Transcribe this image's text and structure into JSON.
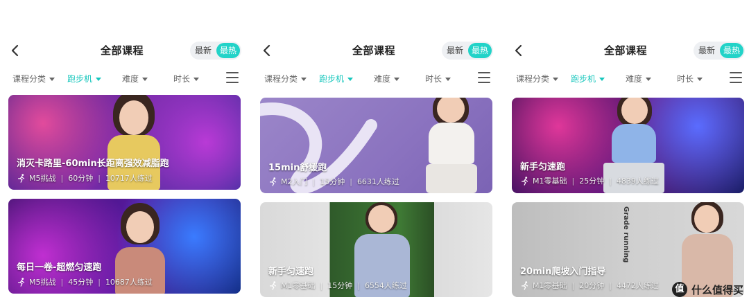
{
  "screens": [
    {
      "title": "全部课程",
      "sort": {
        "new": "最新",
        "hot": "最热"
      },
      "filters": [
        "课程分类",
        "跑步机",
        "难度",
        "时长"
      ],
      "cards": [
        {
          "title": "消灭卡路里-60min长距离强效减脂跑",
          "level": "M5挑战",
          "duration": "60分钟",
          "participants": "10717人练过"
        },
        {
          "title": "每日一卷-超燃匀速跑",
          "level": "M5挑战",
          "duration": "45分钟",
          "participants": "10687人练过"
        }
      ]
    },
    {
      "title": "全部课程",
      "sort": {
        "new": "最新",
        "hot": "最热"
      },
      "filters": [
        "课程分类",
        "跑步机",
        "难度",
        "时长"
      ],
      "cards": [
        {
          "title": "15min舒缓跑",
          "level": "M2入门",
          "duration": "15分钟",
          "participants": "6631人练过"
        },
        {
          "title": "新手匀速跑",
          "level": "M1零基础",
          "duration": "15分钟",
          "participants": "6554人练过"
        }
      ]
    },
    {
      "title": "全部课程",
      "sort": {
        "new": "最新",
        "hot": "最热"
      },
      "filters": [
        "课程分类",
        "跑步机",
        "难度",
        "时长"
      ],
      "cards": [
        {
          "title": "新手匀速跑",
          "level": "M1零基础",
          "duration": "25分钟",
          "participants": "4839人练过"
        },
        {
          "title": "20min爬坡入门指导",
          "level": "M1零基础",
          "duration": "20分钟",
          "participants": "4472人练过",
          "poster_text": "Grade running"
        }
      ]
    }
  ],
  "watermark": {
    "logo": "值",
    "text": "什么值得买"
  },
  "colors": {
    "accent": "#22d3c8",
    "active_filter": "#18c7bd"
  }
}
